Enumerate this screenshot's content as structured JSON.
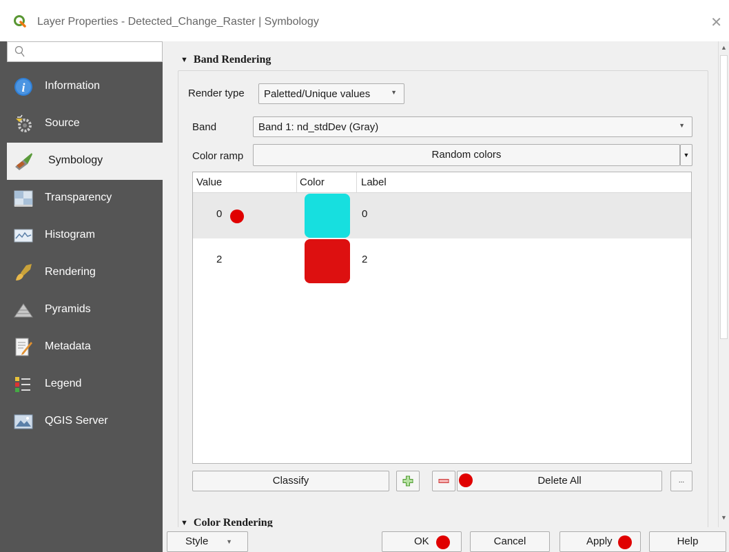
{
  "window": {
    "title": "Layer Properties - Detected_Change_Raster | Symbology",
    "close_glyph": "✕"
  },
  "sidebar": {
    "search_placeholder": "",
    "items": [
      {
        "label": "Information",
        "icon": "info-icon"
      },
      {
        "label": "Source",
        "icon": "source-icon"
      },
      {
        "label": "Symbology",
        "icon": "symbology-icon",
        "active": true
      },
      {
        "label": "Transparency",
        "icon": "transparency-icon"
      },
      {
        "label": "Histogram",
        "icon": "histogram-icon"
      },
      {
        "label": "Rendering",
        "icon": "rendering-icon"
      },
      {
        "label": "Pyramids",
        "icon": "pyramids-icon"
      },
      {
        "label": "Metadata",
        "icon": "metadata-icon"
      },
      {
        "label": "Legend",
        "icon": "legend-icon"
      },
      {
        "label": "QGIS Server",
        "icon": "qgis-server-icon"
      }
    ]
  },
  "band_rendering": {
    "header": "Band Rendering",
    "render_type_label": "Render type",
    "render_type_value": "Paletted/Unique values",
    "band_label": "Band",
    "band_value": "Band 1: nd_stdDev (Gray)",
    "color_ramp_label": "Color ramp",
    "color_ramp_value": "Random colors",
    "table": {
      "columns": [
        "Value",
        "Color",
        "Label"
      ],
      "rows": [
        {
          "value": "0",
          "color": "#17dfdf",
          "label": "0",
          "selected": true
        },
        {
          "value": "2",
          "color": "#dd1010",
          "label": "2",
          "selected": false
        }
      ]
    },
    "classify_label": "Classify",
    "add_glyph": "+",
    "remove_glyph": "−",
    "delete_all_label": "Delete All",
    "more_label": "..."
  },
  "color_rendering": {
    "header": "Color Rendering"
  },
  "footer": {
    "style_label": "Style",
    "ok_label": "OK",
    "cancel_label": "Cancel",
    "apply_label": "Apply",
    "help_label": "Help"
  },
  "colors": {
    "sidebar_bg": "#555555",
    "panel_bg": "#f0f0f0",
    "marker_red": "#e00000"
  }
}
